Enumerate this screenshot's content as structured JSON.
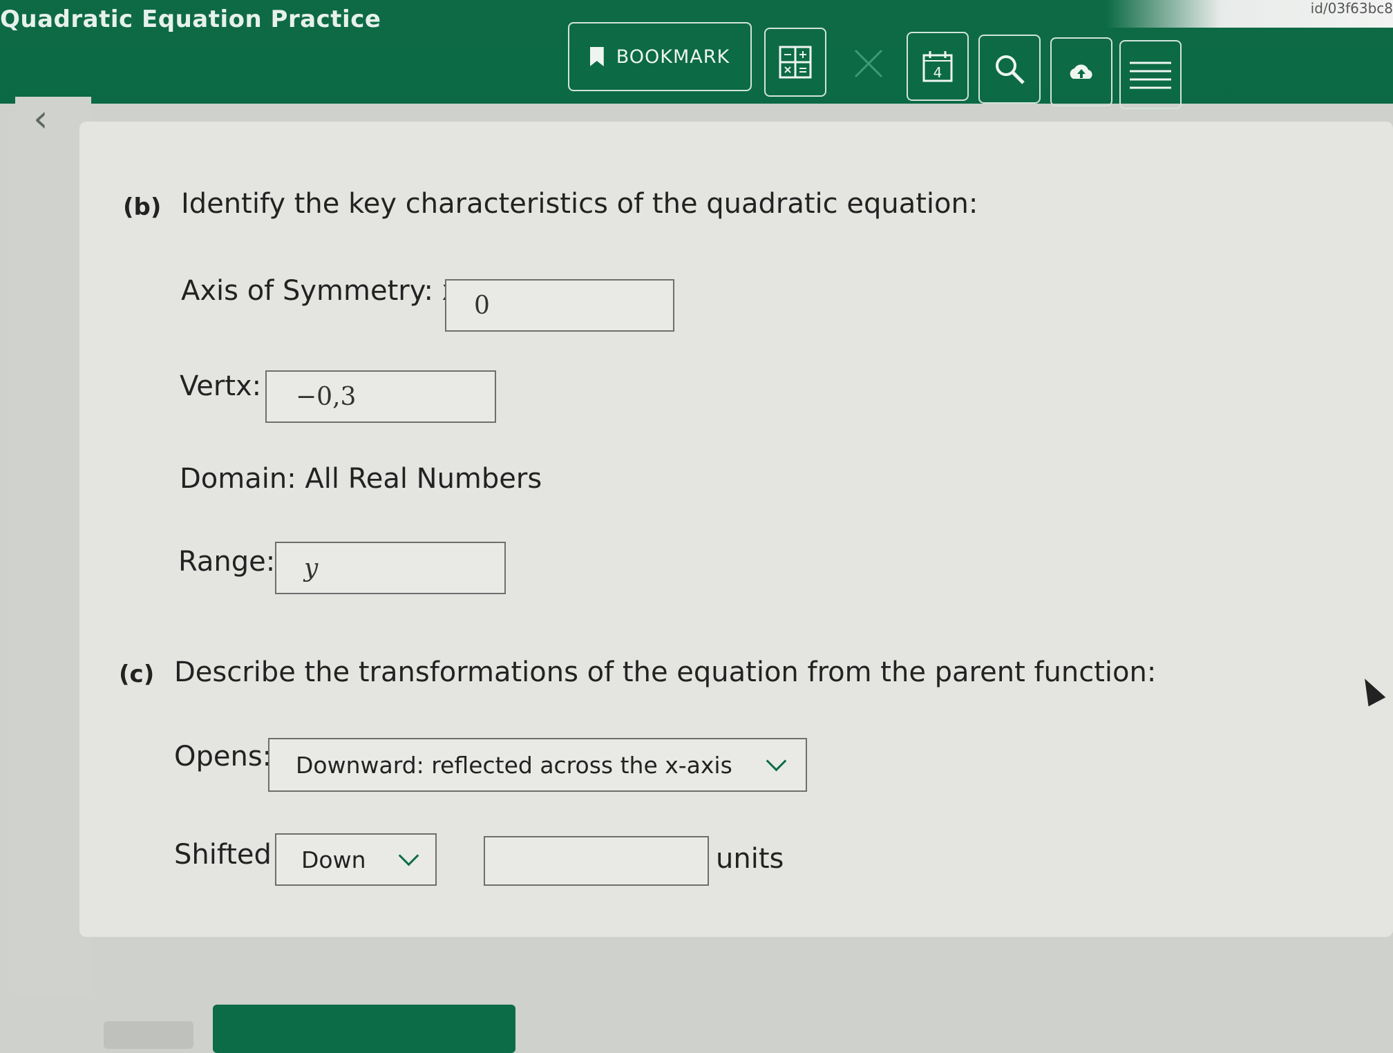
{
  "app": {
    "title": "Quadratic Equation Practice",
    "url_fragment": "id/03f63bc8"
  },
  "toolbar": {
    "bookmark_label": "BOOKMARK",
    "icons": [
      "calculator-grid-icon",
      "close-x-icon",
      "calendar-icon",
      "search-magnifier-icon",
      "cloud-upload-icon",
      "menu-lines-icon"
    ]
  },
  "part_b": {
    "marker": "(b)",
    "prompt": "Identify the key characteristics of the quadratic equation:",
    "axis_label": "Axis of Symmetry: x=",
    "axis_value": "0",
    "vertex_label": "Vertx:",
    "vertex_value": "−0,3",
    "domain_text": "Domain: All Real Numbers",
    "range_label": "Range:",
    "range_value": "y"
  },
  "part_c": {
    "marker": "(c)",
    "prompt": "Describe the transformations of the equation from the parent function:",
    "opens_label": "Opens:",
    "opens_selected": "Downward: reflected across the x-axis",
    "shifted_label": "Shifted",
    "shift_direction": "Down",
    "shift_amount": "",
    "units_label": "units"
  },
  "colors": {
    "header": "#0b6a45",
    "accent": "#0d6c48",
    "panel": "#e4e5e1"
  }
}
